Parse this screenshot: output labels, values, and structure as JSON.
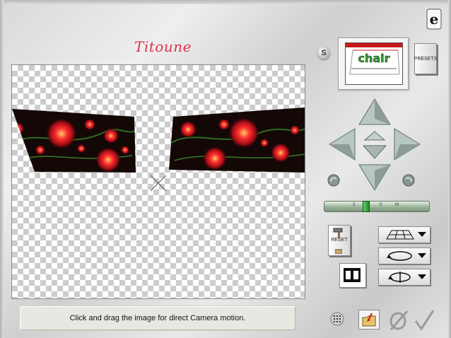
{
  "brand": {
    "name": "Titoune"
  },
  "status": {
    "message": "Click and drag the image for direct Camera motion."
  },
  "preset_thumbnail": {
    "label": "chair"
  },
  "buttons": {
    "s_label": "S",
    "presets_label": "PRESETS",
    "reset_label": "RESET"
  },
  "zoom": {
    "ticks": [
      "2",
      "0",
      "M"
    ],
    "level": 0.4
  },
  "icons": {
    "info": "info-icon",
    "grid": "grid-icon",
    "open": "open-folder-icon",
    "cancel": "cancel-icon",
    "ok": "checkmark-icon",
    "film": "filmstrip-icon",
    "hammer": "hammer-icon"
  },
  "colors": {
    "brand": "#e0304a",
    "nav_button": "#b8c6c0",
    "slider": "#9bb39a",
    "slider_thumb": "#22a02c"
  }
}
